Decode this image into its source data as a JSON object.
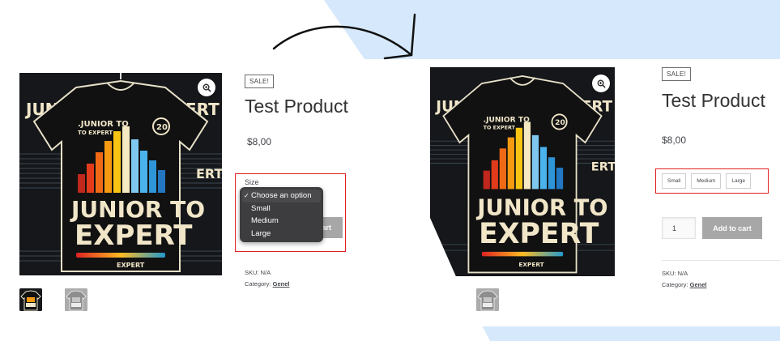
{
  "colors": {
    "background_accent": "#d6e8fb",
    "highlight_border": "#e02020",
    "button_gray": "#a7a7a7",
    "dropdown_bg": "#3d3d3f"
  },
  "product_image": {
    "art_line1": "JUNIOR TO",
    "art_line2": "EXPERT",
    "art_small1": ".JUNIOR TO",
    "art_small2": "TO EXPERT",
    "art_badge": "20",
    "art_footer": "EXPERT",
    "art_side": "JUNI",
    "art_side2": "ERT",
    "art_side3": "ERT"
  },
  "before": {
    "sale_badge": "SALE!",
    "title": "Test Product",
    "price": "$8,00",
    "size_label": "Size",
    "dropdown": {
      "options": [
        "Choose an option",
        "Small",
        "Medium",
        "Large"
      ],
      "selected": "Choose an option"
    },
    "add_to_cart_partial": "art",
    "sku": "SKU: N/A",
    "category_prefix": "Category:",
    "category_link": "Genel"
  },
  "after": {
    "sale_badge": "SALE!",
    "title": "Test Product",
    "price": "$8,00",
    "swatches": [
      "Small",
      "Medium",
      "Large"
    ],
    "quantity": "1",
    "add_to_cart": "Add to cart",
    "sku": "SKU: N/A",
    "category_prefix": "Category:",
    "category_link": "Genel"
  },
  "icons": {
    "zoom": "magnifier-plus-icon",
    "arrow": "curved-arrow-icon",
    "check": "checkmark-icon"
  }
}
